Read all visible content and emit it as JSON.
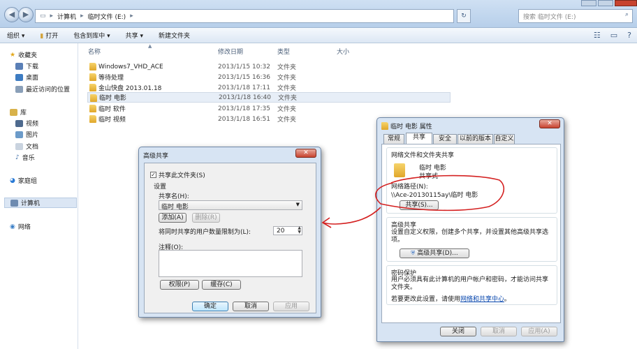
{
  "explorer": {
    "breadcrumb": [
      "计算机",
      "临时文件 (E:)"
    ],
    "search_placeholder": "搜索 临时文件 (E:)",
    "toolbar": {
      "organize": "组织 ▾",
      "open": "打开",
      "include_in_library": "包含到库中 ▾",
      "share": "共享 ▾",
      "new_folder": "新建文件夹"
    },
    "sidebar": {
      "favorites": "收藏夹",
      "download": "下载",
      "desktop": "桌面",
      "recent": "最近访问的位置",
      "libraries": "库",
      "videos": "视频",
      "pictures": "图片",
      "documents": "文档",
      "music": "音乐",
      "homegroup": "家庭组",
      "computer": "计算机",
      "network": "网络"
    },
    "columns": {
      "name": "名称",
      "date": "修改日期",
      "type": "类型",
      "size": "大小"
    },
    "files": [
      {
        "name": "Windows7_VHD_ACE",
        "date": "2013/1/15 10:32",
        "type": "文件夹"
      },
      {
        "name": "等待处理",
        "date": "2013/1/15 16:36",
        "type": "文件夹"
      },
      {
        "name": "金山快盘 2013.01.18",
        "date": "2013/1/18 17:11",
        "type": "文件夹"
      },
      {
        "name": "临时 电影",
        "date": "2013/1/18 16:40",
        "type": "文件夹"
      },
      {
        "name": "临时 软件",
        "date": "2013/1/18 17:35",
        "type": "文件夹"
      },
      {
        "name": "临时 视频",
        "date": "2013/1/18 16:51",
        "type": "文件夹"
      }
    ]
  },
  "advanced_share": {
    "title": "高级共享",
    "share_checkbox": "共享此文件夹(S)",
    "settings_label": "设置",
    "share_name_label": "共享名(H):",
    "share_name_value": "临时 电影",
    "add_btn": "添加(A)",
    "remove_btn": "删除(R)",
    "limit_label": "将同时共享的用户数量限制为(L):",
    "limit_value": "20",
    "comment_label": "注释(O):",
    "permissions_btn": "权限(P)",
    "cache_btn": "缓存(C)",
    "ok_btn": "确定",
    "cancel_btn": "取消",
    "apply_btn": "应用"
  },
  "properties": {
    "title": "临时 电影 属性",
    "tabs": [
      "常规",
      "共享",
      "安全",
      "以前的版本",
      "自定义"
    ],
    "net_section": "网络文件和文件夹共享",
    "folder_name": "临时 电影",
    "folder_status": "共享式",
    "net_path_label": "网络路径(N):",
    "net_path_value": "\\\\Ace-20130115ay\\临时 电影",
    "share_btn": "共享(S)...",
    "adv_section": "高级共享",
    "adv_desc": "设置自定义权限，创建多个共享，并设置其他高级共享选项。",
    "adv_btn": "高级共享(D)...",
    "pwd_section": "密码保护",
    "pwd_desc": "用户必须具有此计算机的用户帐户和密码，才能访问共享文件夹。",
    "pwd_change_prefix": "若要更改此设置，请使用",
    "pwd_link": "网络和共享中心",
    "pwd_change_suffix": "。",
    "close_btn": "关闭",
    "cancel_btn": "取消",
    "apply_btn": "应用(A)"
  },
  "colors": {
    "annotation": "#d42020",
    "selected_row": "#e7eef7",
    "title_bar": "#d7e4f3"
  }
}
